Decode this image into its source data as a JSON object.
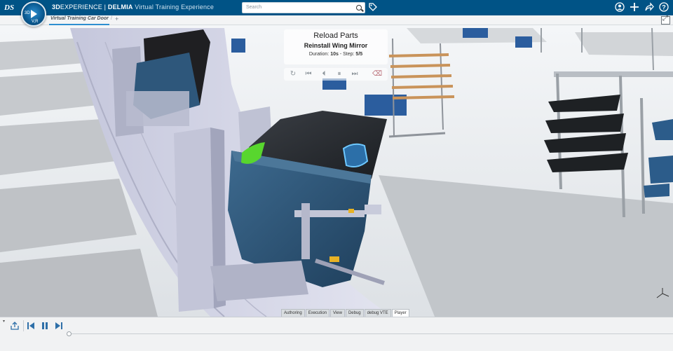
{
  "header": {
    "logo_icon": "ds-logo-icon",
    "compass_label": "3D",
    "compass_version": "V,R",
    "brand_3d": "3D",
    "brand_experience": "EXPERIENCE",
    "brand_sep": " | ",
    "brand_delmia": "DELMIA",
    "app_name": "Virtual Training Experience",
    "search_placeholder": "Search",
    "icons": [
      "tag-icon",
      "user-icon",
      "add-icon",
      "share-icon",
      "help-icon"
    ]
  },
  "tabs": {
    "active_label": "Virtual Training Car Door",
    "separator": "/",
    "add_label": "+"
  },
  "step_panel": {
    "title": "Reload Parts",
    "subtitle": "Reinstall Wing Mirror",
    "duration_label": "Duration:",
    "duration_value": "10s",
    "step_label": "Step:",
    "step_value": "5/5",
    "controls": [
      "restart-icon",
      "skip-back-icon",
      "step-back-icon",
      "pause-icon",
      "skip-forward-icon",
      "eraser-icon"
    ]
  },
  "mode_tabs": [
    "Authoring",
    "Execution",
    "View",
    "Debug",
    "debug VTE",
    "Player"
  ],
  "active_mode": "Player",
  "timeline": {
    "collapse_label": "▾",
    "buttons": [
      "export-icon",
      "step-back-icon",
      "pause-icon",
      "step-forward-icon"
    ],
    "progress": 0
  },
  "colors": {
    "header_bg": "#005386",
    "accent": "#2e8fd0",
    "door_panel": "#33597a",
    "highlight_green": "#58d62e"
  }
}
